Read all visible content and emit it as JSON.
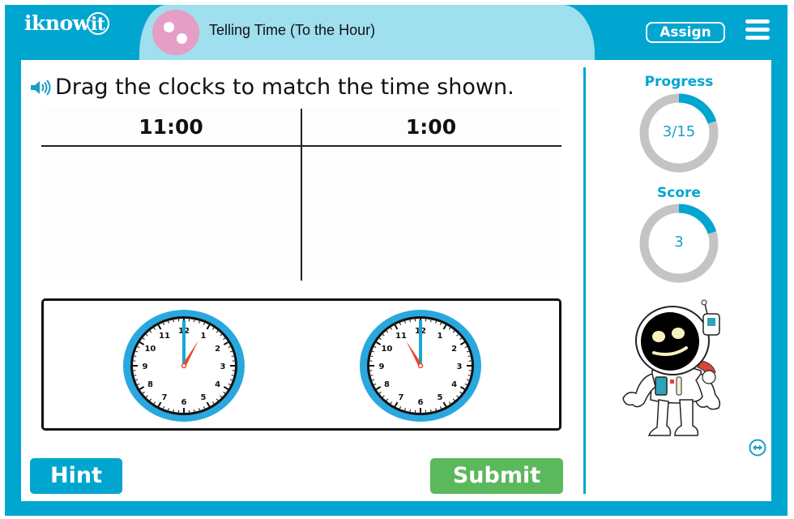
{
  "header": {
    "logo": "iknow",
    "logo_bulb": "it",
    "lesson_title": "Telling Time (To the Hour)",
    "assign_label": "Assign",
    "menu_icon": "hamburger-menu-icon"
  },
  "question": {
    "speaker_icon": "speaker-icon",
    "instruction": "Drag the clocks to match the time shown.",
    "columns": [
      {
        "label": "11:00"
      },
      {
        "label": "1:00"
      }
    ],
    "draggable_clocks": [
      {
        "hour": 1,
        "minute": 0,
        "shows": "1:00"
      },
      {
        "hour": 11,
        "minute": 0,
        "shows": "11:00"
      }
    ],
    "clock_numbers": [
      "12",
      "1",
      "2",
      "3",
      "4",
      "5",
      "6",
      "7",
      "8",
      "9",
      "10",
      "11"
    ]
  },
  "buttons": {
    "hint": "Hint",
    "submit": "Submit"
  },
  "sidebar": {
    "progress": {
      "label": "Progress",
      "current": 3,
      "total": 15,
      "text": "3/15"
    },
    "score": {
      "label": "Score",
      "value": 3,
      "fraction": 0.2,
      "text": "3"
    },
    "mascot": "astronaut-robot",
    "expand_icon": "expand-arrows-icon"
  },
  "colors": {
    "brand_blue": "#00a6cf",
    "title_bar": "#9fdfee",
    "title_icon": "#e59ec5",
    "submit_green": "#5cb85c",
    "ring_gray": "#c4c4c4",
    "clock_rim": "#29a8e0",
    "hour_hand": "#e8472f",
    "minute_hand": "#1aa7d6"
  }
}
